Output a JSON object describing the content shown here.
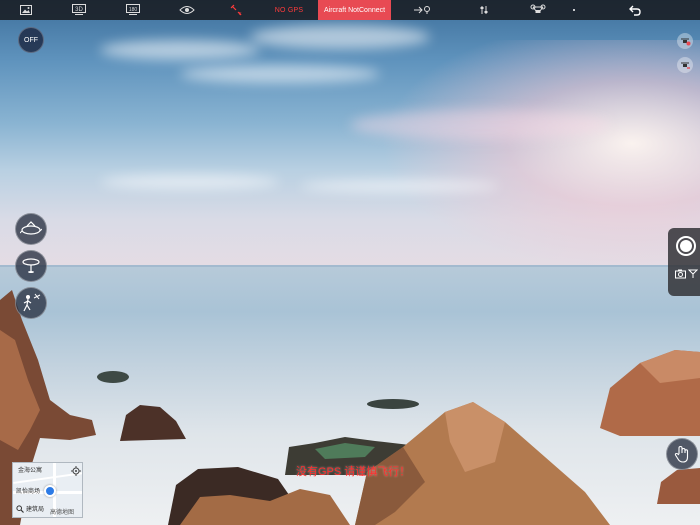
{
  "topbar": {
    "items": [
      {
        "name": "gallery-icon"
      },
      {
        "name": "3d-mode-icon",
        "label": "3D"
      },
      {
        "name": "180-mode-icon",
        "label": "180"
      },
      {
        "name": "eye-icon"
      },
      {
        "name": "satellite-icon"
      },
      {
        "name": "no-gps-status",
        "label": "NO GPS"
      },
      {
        "name": "aircraft-status",
        "label": "Aircraft NotConnect"
      },
      {
        "name": "route-icon"
      },
      {
        "name": "settings-sliders-icon"
      },
      {
        "name": "drone-icon"
      },
      {
        "name": "back-icon"
      }
    ],
    "three_d": "3D",
    "one_eighty": "180",
    "no_gps": "NO GPS",
    "aircraft": "Aircraft NotConnect"
  },
  "left_controls": {
    "off_label": "OFF",
    "buttons": [
      "orbit-mode-icon",
      "circle-mode-icon",
      "follow-me-icon"
    ]
  },
  "right_controls": {
    "mini_buttons": [
      "drone-warning-icon",
      "drone-return-icon"
    ],
    "camera_panel": [
      "shutter-button",
      "photo-mode-icon",
      "video-mode-icon"
    ],
    "gesture_icon": "gesture-control-icon"
  },
  "warning": "没有GPS 请谨慎飞行！",
  "minimap": {
    "label1": "金海公寓",
    "label2": "凯怡商场",
    "label3": "建筑局",
    "label4": "高德地图"
  },
  "colors": {
    "topbar_bg": "#1c1f26",
    "alert_red": "#e84a53",
    "warning_text": "#ff2d2d",
    "location_blue": "#2d7be6"
  }
}
